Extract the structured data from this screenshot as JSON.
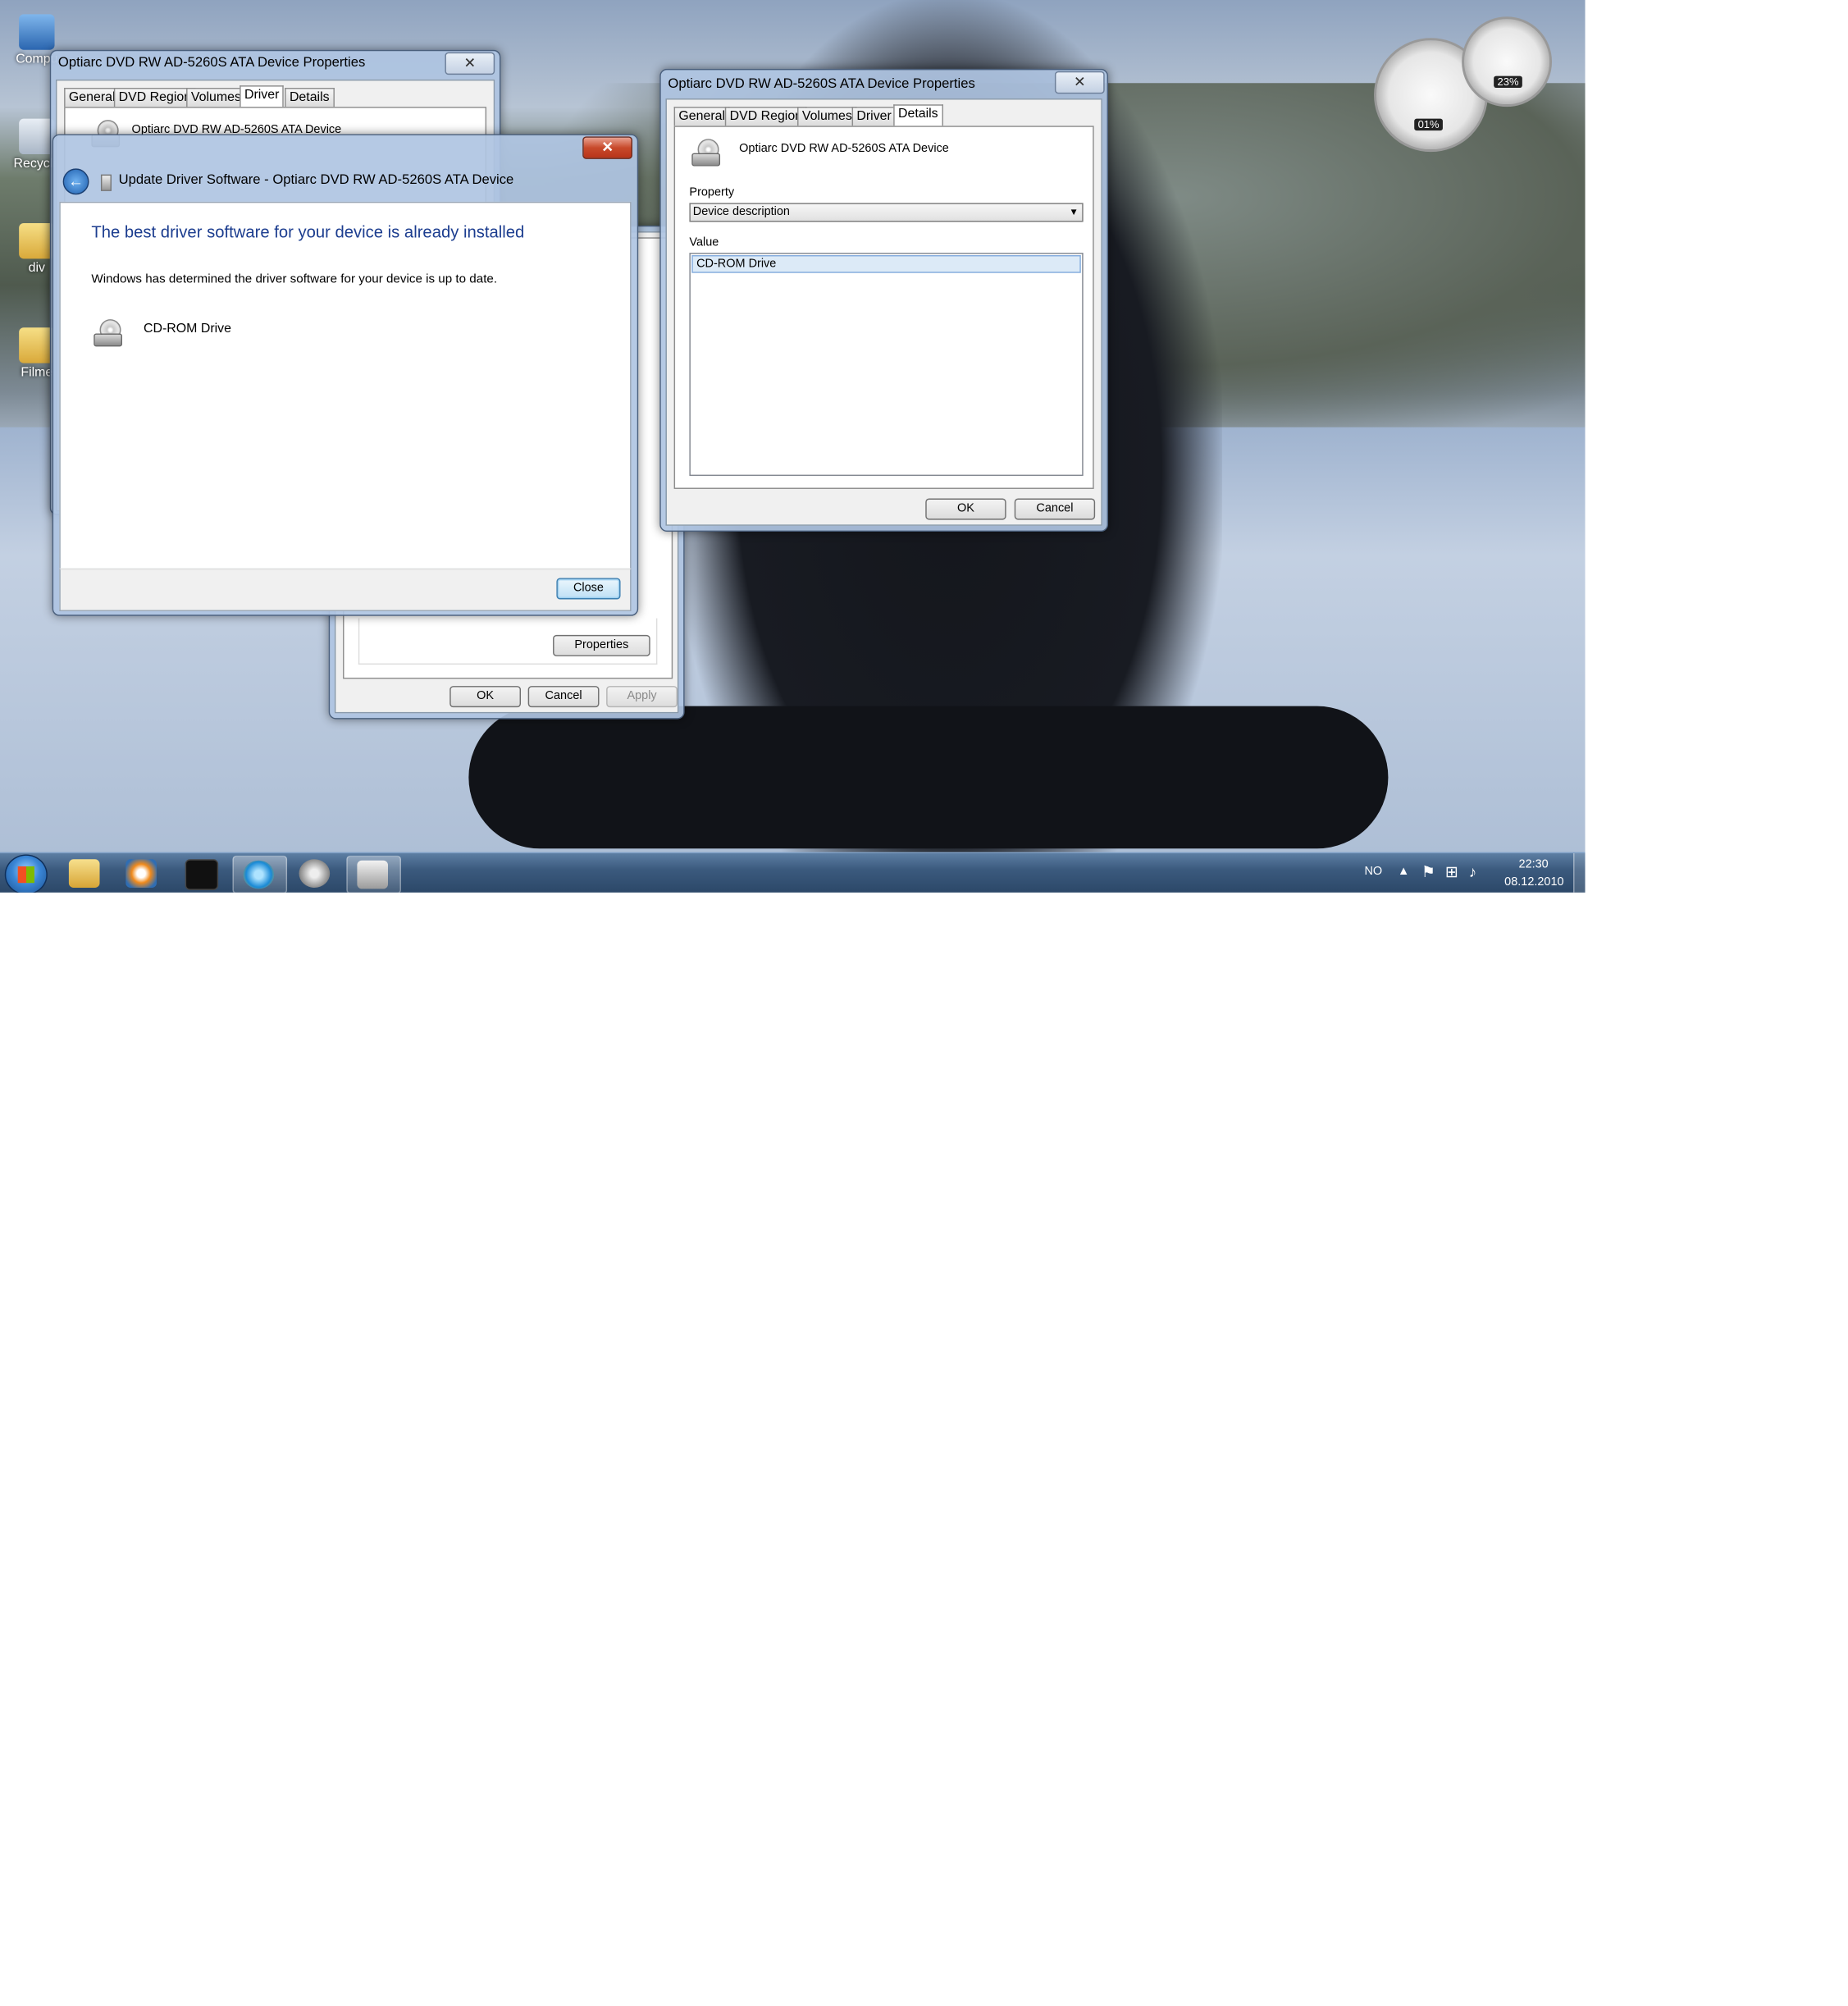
{
  "desktop": {
    "icons": [
      {
        "label": "Compu"
      },
      {
        "label": "Recycle"
      },
      {
        "label": "div"
      },
      {
        "label": "Filme"
      }
    ],
    "gadgets": {
      "cpu": "01%",
      "memory": "23%"
    }
  },
  "props_back": {
    "title": "Optiarc DVD RW AD-5260S ATA Device Properties",
    "tabs": [
      "General",
      "DVD Region",
      "Volumes",
      "Driver",
      "Details"
    ],
    "device_name": "Optiarc DVD RW AD-5260S ATA Device",
    "properties_button": "Properties",
    "ok": "OK",
    "cancel": "Cancel",
    "apply": "Apply"
  },
  "update_driver": {
    "title": "Update Driver Software - Optiarc DVD RW AD-5260S ATA Device",
    "heading": "The best driver software for your device is already installed",
    "message": "Windows has determined the driver software for your device is up to date.",
    "device": "CD-ROM Drive",
    "close": "Close",
    "close_x": "✕"
  },
  "props_front": {
    "title": "Optiarc DVD RW AD-5260S ATA Device Properties",
    "tabs": [
      "General",
      "DVD Region",
      "Volumes",
      "Driver",
      "Details"
    ],
    "device_name": "Optiarc DVD RW AD-5260S ATA Device",
    "property_label": "Property",
    "property_value": "Device description",
    "value_label": "Value",
    "value_item": "CD-ROM Drive",
    "ok": "OK",
    "cancel": "Cancel",
    "close_x": "✕"
  },
  "taskbar": {
    "language": "NO",
    "time": "22:30",
    "date": "08.12.2010"
  }
}
